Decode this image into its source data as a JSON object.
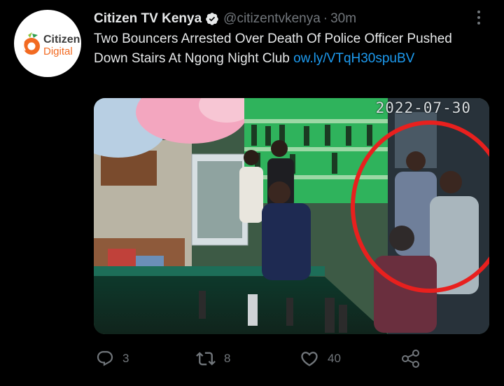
{
  "tweet": {
    "author_name": "Citizen TV Kenya",
    "handle": "@citizentvkenya",
    "separator": "·",
    "time": "30m",
    "text": "Two Bouncers Arrested Over Death Of Police Officer Pushed Down Stairs At Ngong Night Club ",
    "link_text": "ow.ly/​VTqH30spuBV",
    "avatar_brand_line1": "Citizen",
    "avatar_brand_line2": "Digital",
    "media_timestamp": "2022-07-30",
    "icons": {
      "verified": "verified-badge-icon",
      "more": "more-options-icon",
      "reply": "reply-icon",
      "retweet": "retweet-icon",
      "like": "like-icon",
      "share": "share-icon"
    },
    "colors": {
      "background": "#000000",
      "link": "#1d9bf0",
      "muted": "#71767b",
      "brand_orange": "#f26a21",
      "highlight_circle": "#e8201e"
    }
  },
  "actions": {
    "reply_count": "3",
    "retweet_count": "8",
    "like_count": "40"
  }
}
